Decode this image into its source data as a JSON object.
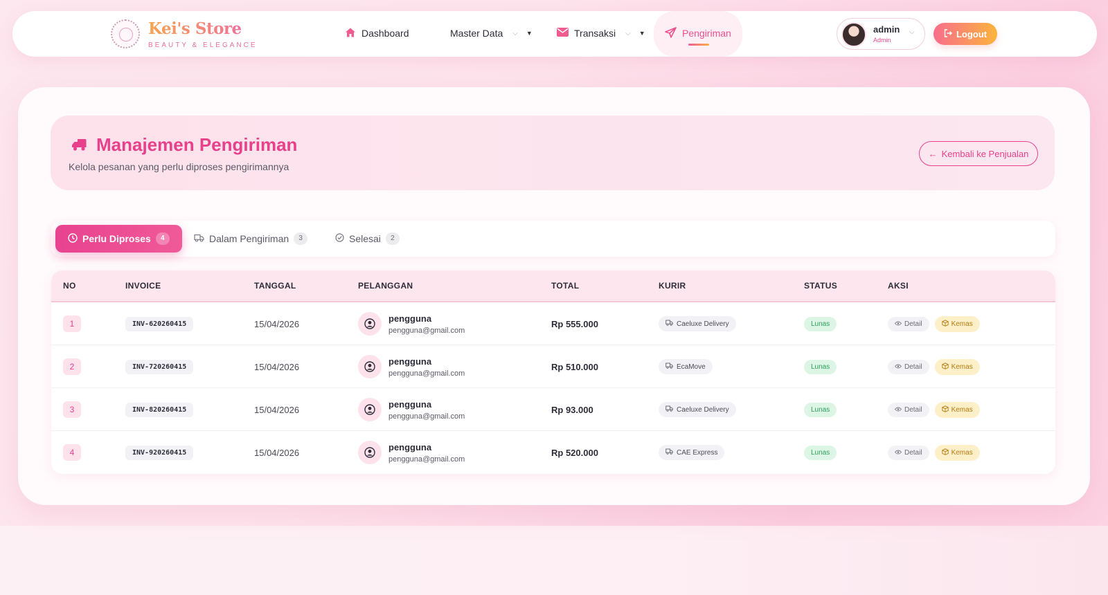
{
  "brand": {
    "title": "Kei's Store",
    "subtitle": "BEAUTY & ELEGANCE"
  },
  "nav": {
    "dashboard": "Dashboard",
    "master_data": "Master Data",
    "transaksi": "Transaksi",
    "pengiriman": "Pengiriman"
  },
  "user": {
    "name": "admin",
    "role": "Admin"
  },
  "logout_label": "Logout",
  "header": {
    "title": "Manajemen Pengiriman",
    "subtitle": "Kelola pesanan yang perlu diproses pengirimannya",
    "back_label": "Kembali ke Penjualan"
  },
  "tabs": [
    {
      "label": "Perlu Diproses",
      "count": "4"
    },
    {
      "label": "Dalam Pengiriman",
      "count": "3"
    },
    {
      "label": "Selesai",
      "count": "2"
    }
  ],
  "table": {
    "columns": [
      "NO",
      "INVOICE",
      "TANGGAL",
      "PELANGGAN",
      "TOTAL",
      "KURIR",
      "STATUS",
      "AKSI"
    ],
    "rows": [
      {
        "no": "1",
        "invoice": "INV-620260415",
        "date": "15/04/2026",
        "customer": "pengguna",
        "email": "pengguna@gmail.com",
        "total": "Rp 555.000",
        "courier": "Caeluxe Delivery",
        "status": "Lunas"
      },
      {
        "no": "2",
        "invoice": "INV-720260415",
        "date": "15/04/2026",
        "customer": "pengguna",
        "email": "pengguna@gmail.com",
        "total": "Rp 510.000",
        "courier": "EcaMove",
        "status": "Lunas"
      },
      {
        "no": "3",
        "invoice": "INV-820260415",
        "date": "15/04/2026",
        "customer": "pengguna",
        "email": "pengguna@gmail.com",
        "total": "Rp 93.000",
        "courier": "Caeluxe Delivery",
        "status": "Lunas"
      },
      {
        "no": "4",
        "invoice": "INV-920260415",
        "date": "15/04/2026",
        "customer": "pengguna",
        "email": "pengguna@gmail.com",
        "total": "Rp 520.000",
        "courier": "CAE Express",
        "status": "Lunas"
      }
    ],
    "detail_label": "Detail",
    "kemas_label": "Kemas"
  },
  "colors": {
    "accent": "#e7418c",
    "status_paid_bg": "#ddf5e5",
    "status_paid_text": "#2e9e5b",
    "kemas_bg": "#fdf0c8"
  },
  "icons": {
    "dashboard": "home-icon",
    "master_data": "chevron-down-icon",
    "transaksi": "envelope-icon",
    "pengiriman": "send-icon",
    "header": "truck-icon",
    "tab_pending": "clock-icon",
    "tab_shipping": "truck-icon",
    "tab_done": "check-circle-icon",
    "customer": "user-circle-icon",
    "courier": "truck-icon",
    "detail": "eye-icon",
    "kemas": "box-icon",
    "back": "arrow-left-icon",
    "logout": "logout-icon"
  }
}
